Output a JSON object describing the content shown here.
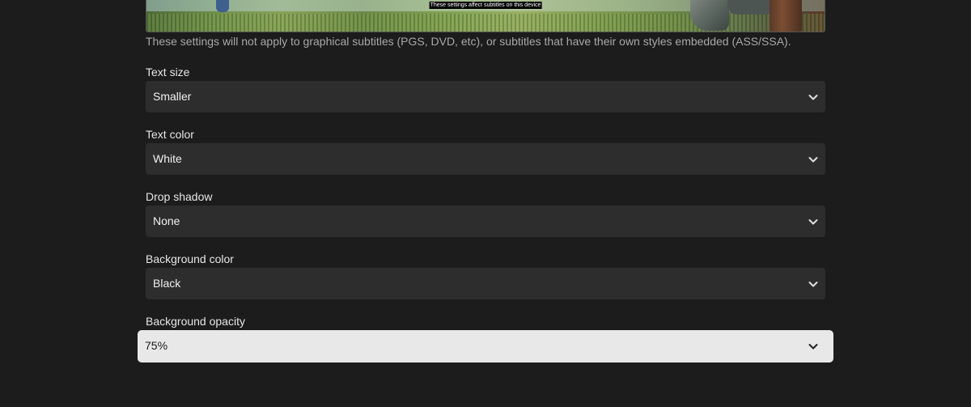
{
  "preview": {
    "caption": "These settings affect subtitles on this device"
  },
  "note": "These settings will not apply to graphical subtitles (PGS, DVD, etc), or subtitles that have their own styles embedded (ASS/SSA).",
  "fields": [
    {
      "label": "Text size",
      "value": "Smaller",
      "icon": "chevron-down-icon"
    },
    {
      "label": "Text color",
      "value": "White",
      "icon": "chevron-down-icon"
    },
    {
      "label": "Drop shadow",
      "value": "None",
      "icon": "chevron-down-icon"
    },
    {
      "label": "Background color",
      "value": "Black",
      "icon": "chevron-down-icon"
    },
    {
      "label": "Background opacity",
      "value": "75%",
      "icon": "chevron-down-icon",
      "focused": true
    }
  ],
  "colors": {
    "page_background": "#1c1c1c",
    "select_background": "#2d2d2d",
    "focused_select_background": "#e8e8e8"
  }
}
